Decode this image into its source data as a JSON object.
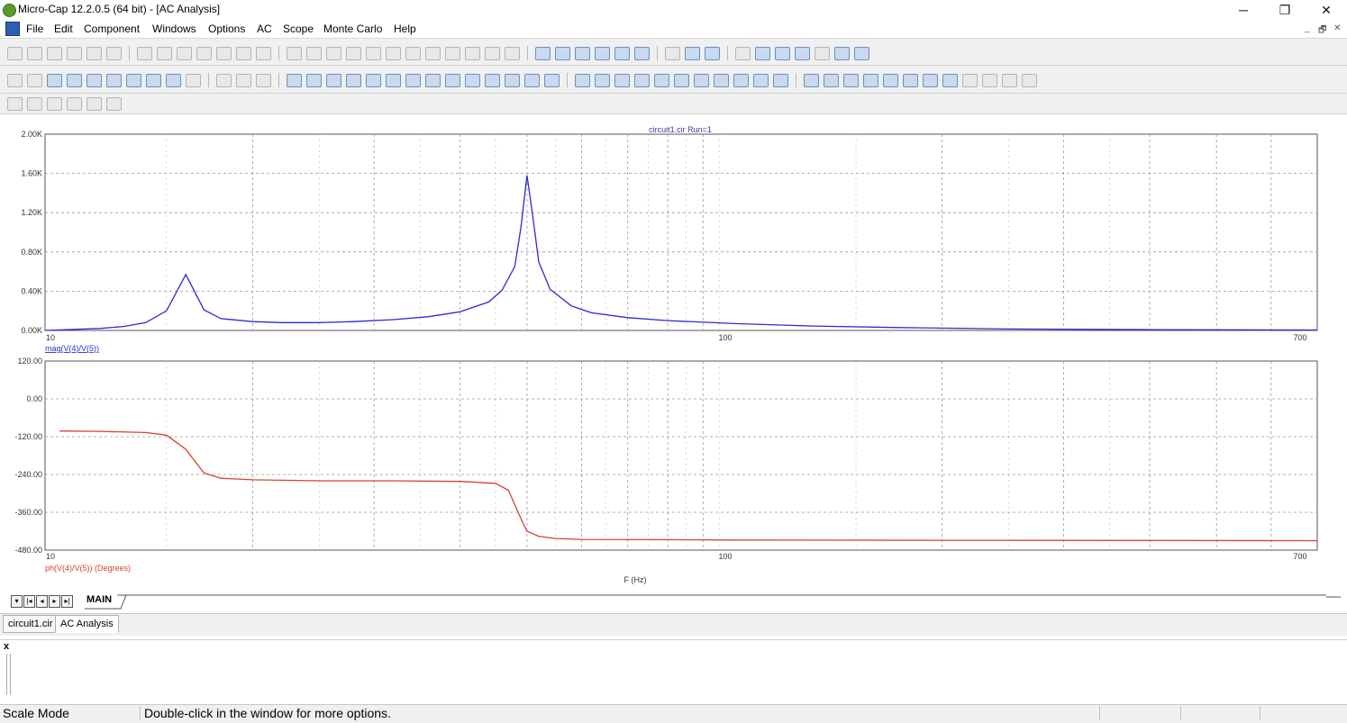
{
  "window": {
    "title": "Micro-Cap 12.2.0.5 (64 bit) - [AC Analysis]",
    "controls": {
      "minimize": "─",
      "restore": "❐",
      "close": "✕"
    }
  },
  "menu": [
    "File",
    "Edit",
    "Component",
    "Windows",
    "Options",
    "AC",
    "Scope",
    "Monte Carlo",
    "Help"
  ],
  "mdi_controls": {
    "minimize": "_",
    "restore": "🗗",
    "close": "✕"
  },
  "plot": {
    "title": "circuit1.cir Run=1",
    "top": {
      "label": "mag(V(4)/V(5))",
      "color": "#2b2bd6",
      "yticks": [
        "2.00K",
        "1.60K",
        "1.20K",
        "0.80K",
        "0.40K",
        "0.00K"
      ],
      "xticks": [
        "10",
        "100",
        "700"
      ]
    },
    "bottom": {
      "label": "ph(V(4)/V(5)) (Degrees)",
      "color": "#d9412e",
      "yticks": [
        "120.00",
        "0.00",
        "-120.00",
        "-240.00",
        "-360.00",
        "-480.00"
      ],
      "xticks": [
        "10",
        "100",
        "700"
      ]
    },
    "xlabel": "F (Hz)"
  },
  "chart_data": [
    {
      "type": "line",
      "title": "circuit1.cir Run=1",
      "xscale": "log",
      "xlim": [
        10,
        700
      ],
      "ylim": [
        0,
        2000
      ],
      "grid": true,
      "series": [
        {
          "name": "mag(V(4)/V(5))",
          "x": [
            10,
            12,
            13,
            14,
            15,
            16,
            17,
            18,
            20,
            22,
            25,
            28,
            32,
            36,
            40,
            44,
            46,
            48,
            49,
            50,
            51,
            52,
            54,
            58,
            62,
            70,
            80,
            100,
            130,
            170,
            250,
            400,
            700
          ],
          "y": [
            0,
            20,
            40,
            80,
            200,
            570,
            210,
            120,
            90,
            80,
            80,
            90,
            110,
            140,
            190,
            290,
            410,
            650,
            1050,
            1580,
            1150,
            700,
            420,
            250,
            180,
            130,
            100,
            70,
            45,
            30,
            15,
            8,
            5
          ]
        }
      ]
    },
    {
      "type": "line",
      "xscale": "log",
      "xlim": [
        10,
        700
      ],
      "ylim": [
        -480,
        120
      ],
      "grid": true,
      "series": [
        {
          "name": "ph(V(4)/V(5)) (Degrees)",
          "x": [
            10.5,
            12,
            14,
            15,
            16,
            17,
            18,
            20,
            25,
            32,
            40,
            45,
            47,
            49,
            50,
            51,
            52,
            55,
            60,
            80,
            100,
            200,
            700
          ],
          "y": [
            -102,
            -103,
            -107,
            -115,
            -160,
            -235,
            -252,
            -257,
            -260,
            -260,
            -262,
            -268,
            -290,
            -380,
            -420,
            -428,
            -436,
            -443,
            -446,
            -447,
            -448,
            -449,
            -450
          ]
        }
      ]
    }
  ],
  "sheet_tab": "MAIN",
  "doc_tabs": [
    "circuit1.cir",
    "AC Analysis"
  ],
  "output": {
    "close": "x"
  },
  "status": {
    "mode": "Scale Mode",
    "hint": "Double-click in the window for more options."
  }
}
